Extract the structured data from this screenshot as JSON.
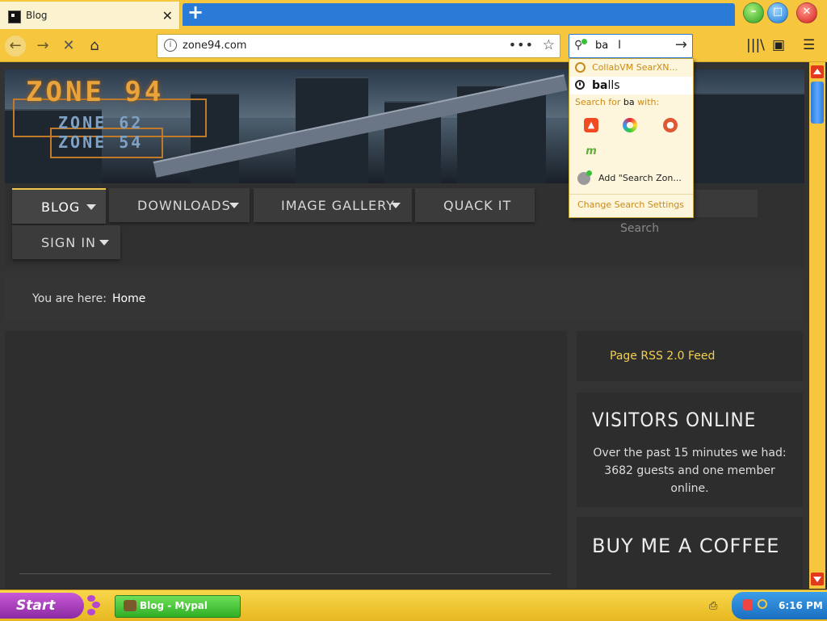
{
  "browser": {
    "tab": {
      "title": "Blog",
      "close": "✕"
    },
    "new_tab": "+",
    "url": "zone94.com",
    "page_actions": "•••",
    "bookmark": "☆",
    "search_query": "ba",
    "search_go": "→",
    "nav": {
      "back": "←",
      "forward": "→",
      "stop": "✕",
      "home": "⌂"
    },
    "toolbar": {
      "library": "|||\\",
      "sidebar": "▣",
      "menu": "☰"
    },
    "window_controls": {
      "minimize": "–",
      "maximize": "□",
      "close": "✕"
    }
  },
  "search_dropdown": {
    "engine": "CollabVM SearXN...",
    "suggestion_bold": "ba",
    "suggestion_rest": "lls",
    "search_for_prefix": "Search for ",
    "search_for_query": "ba",
    "search_for_suffix": " with:",
    "engines": [
      "brave-icon",
      "qwant-icon",
      "duckduckgo-icon",
      "mojeek-icon"
    ],
    "mojeek_letter": "m",
    "add_engine": "Add \"Search Zon...",
    "settings": "Change Search Settings"
  },
  "site": {
    "logo_main": "ZONE 94",
    "logo_sub1": "ZONE 62",
    "logo_sub2": "ZONE 54",
    "menu": [
      {
        "label": "BLOG",
        "has_dropdown": true,
        "active": true
      },
      {
        "label": "DOWNLOADS",
        "has_dropdown": true
      },
      {
        "label": "IMAGE GALLERY",
        "has_dropdown": true
      },
      {
        "label": "QUACK IT",
        "has_dropdown": false
      },
      {
        "label": "SIGN IN",
        "has_dropdown": true
      }
    ],
    "search_placeholder": "Search",
    "breadcrumb": {
      "label": "You are here:",
      "current": "Home"
    },
    "sidebar": {
      "rss": "Page RSS 2.0 Feed",
      "visitors_title": "VISITORS ONLINE",
      "visitors_text": "Over the past 15 minutes we had: 3682 guests and one member online.",
      "coffee_title": "BUY ME A COFFEE"
    }
  },
  "taskbar": {
    "start": "Start",
    "task": "Blog - Mypal",
    "clock": "6:16 PM"
  },
  "colors": {
    "accent": "#f7c63f",
    "link": "#f2d14e",
    "tab_blue": "#2a7bd8"
  }
}
